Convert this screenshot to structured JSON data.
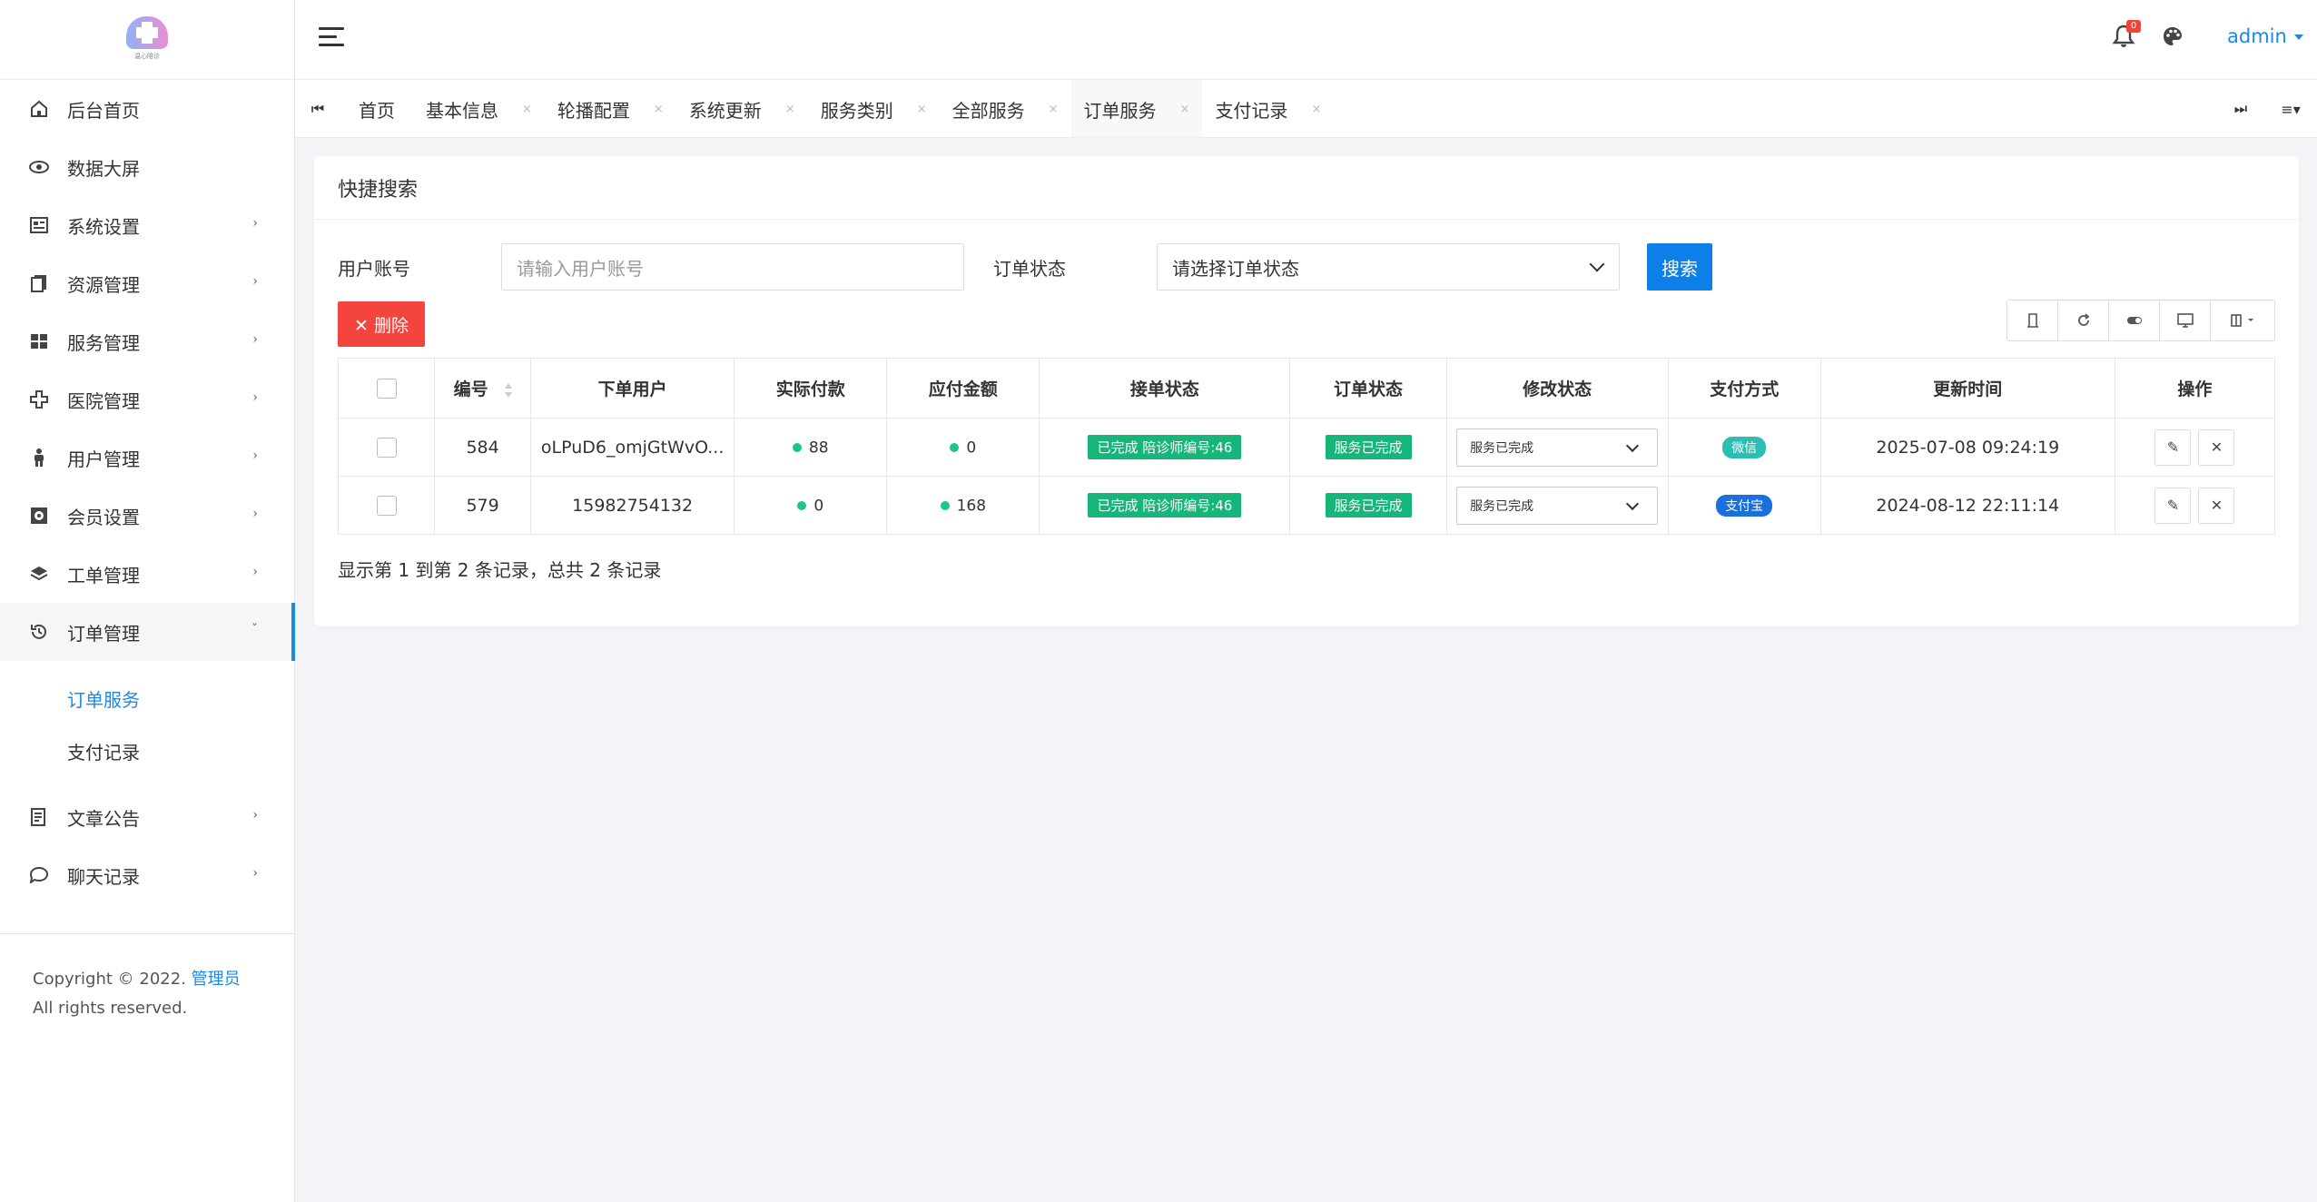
{
  "logo": {
    "text": "温心陪诊"
  },
  "sidebar": {
    "items": [
      {
        "label": "后台首页",
        "icon": "home-icon",
        "has_arrow": false
      },
      {
        "label": "数据大屏",
        "icon": "eye-icon",
        "has_arrow": false
      },
      {
        "label": "系统设置",
        "icon": "settings-panel-icon",
        "has_arrow": true
      },
      {
        "label": "资源管理",
        "icon": "files-icon",
        "has_arrow": true
      },
      {
        "label": "服务管理",
        "icon": "grid-icon",
        "has_arrow": true
      },
      {
        "label": "医院管理",
        "icon": "plus-cross-icon",
        "has_arrow": true
      },
      {
        "label": "用户管理",
        "icon": "person-icon",
        "has_arrow": true
      },
      {
        "label": "会员设置",
        "icon": "member-card-icon",
        "has_arrow": true
      },
      {
        "label": "工单管理",
        "icon": "layers-icon",
        "has_arrow": true
      },
      {
        "label": "订单管理",
        "icon": "history-icon",
        "has_arrow": true
      }
    ],
    "order_sub": [
      "订单服务",
      "支付记录"
    ],
    "bottom_items": [
      {
        "label": "文章公告",
        "icon": "article-icon"
      },
      {
        "label": "聊天记录",
        "icon": "chat-icon"
      }
    ],
    "arrow_right": "›",
    "arrow_down": "ˇ",
    "footer": {
      "prefix": "Copyright © 2022. ",
      "link": "管理员",
      "suffix": " All rights reserved."
    }
  },
  "topbar": {
    "badge": "0",
    "user": "admin"
  },
  "tabs": {
    "items": [
      {
        "label": "首页",
        "closable": false
      },
      {
        "label": "基本信息",
        "closable": true
      },
      {
        "label": "轮播配置",
        "closable": true
      },
      {
        "label": "系统更新",
        "closable": true
      },
      {
        "label": "服务类别",
        "closable": true
      },
      {
        "label": "全部服务",
        "closable": true
      },
      {
        "label": "订单服务",
        "closable": true
      },
      {
        "label": "支付记录",
        "closable": true
      }
    ],
    "close_glyph": "×",
    "first_glyph": "⏮",
    "last_glyph": "⏭",
    "menu_glyph": "≡▾"
  },
  "search": {
    "title": "快捷搜索",
    "account_label": "用户账号",
    "account_placeholder": "请输入用户账号",
    "status_label": "订单状态",
    "status_placeholder": "请选择订单状态",
    "search_button": "搜索",
    "delete_button": "✕ 删除"
  },
  "table": {
    "headers": [
      "编号",
      "下单用户",
      "实际付款",
      "应付金额",
      "接单状态",
      "订单状态",
      "修改状态",
      "支付方式",
      "更新时间",
      "操作"
    ],
    "rows": [
      {
        "id": "584",
        "user": "oLPuD6_omjGtWvO...",
        "paid": "88",
        "due": "0",
        "accept": "已完成 陪诊师编号:46",
        "status": "服务已完成",
        "modify": "服务已完成",
        "pay": "微信",
        "pay_style": "teal",
        "time": "2025-07-08 09:24:19"
      },
      {
        "id": "579",
        "user": "15982754132",
        "paid": "0",
        "due": "168",
        "accept": "已完成 陪诊师编号:46",
        "status": "服务已完成",
        "modify": "服务已完成",
        "pay": "支付宝",
        "pay_style": "blue",
        "time": "2024-08-12 22:11:14"
      }
    ],
    "pager": "显示第 1 到第 2 条记录，总共 2 条记录"
  }
}
